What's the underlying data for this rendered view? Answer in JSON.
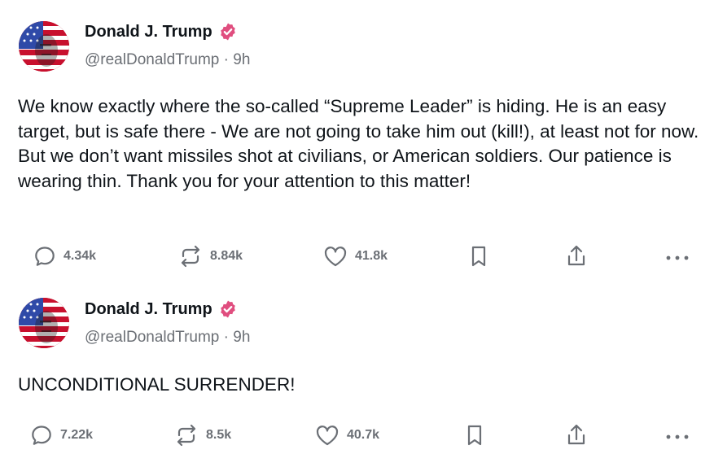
{
  "posts": [
    {
      "author": {
        "name": "Donald J. Trump",
        "handle": "@realDonaldTrump",
        "time": "9h",
        "verified": true
      },
      "text": "We know exactly where the so-called “Supreme Leader” is hiding. He is an easy target, but is safe there - We are not going to take him out (kill!), at least not for now. But we don’t want missiles shot at civilians, or American soldiers. Our patience is wearing thin. Thank you for your attention to this matter!",
      "replies": "4.34k",
      "reposts": "8.84k",
      "likes": "41.8k"
    },
    {
      "author": {
        "name": "Donald J. Trump",
        "handle": "@realDonaldTrump",
        "time": "9h",
        "verified": true
      },
      "text": "UNCONDITIONAL SURRENDER!",
      "replies": "7.22k",
      "reposts": "8.5k",
      "likes": "40.7k"
    }
  ],
  "meta_separator": "·",
  "icons": [
    "reply-icon",
    "repost-icon",
    "like-icon",
    "bookmark-icon",
    "share-icon",
    "more-icon",
    "verified-badge-icon"
  ],
  "colors": {
    "verified_badge": "#e04e7f",
    "muted_text": "#6b6f75",
    "primary_text": "#0f1419",
    "icon": "#6b6f75"
  }
}
